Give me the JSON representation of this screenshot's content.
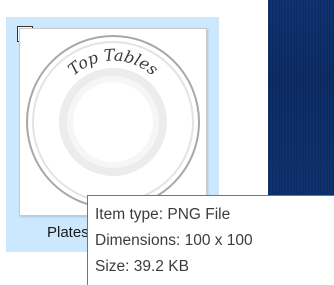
{
  "tile": {
    "label": "Plates",
    "selected": true,
    "thumbnail": {
      "plate_text": "Top Tables",
      "icon": "plate-image"
    }
  },
  "tooltip": {
    "item_type": "Item type: PNG File",
    "dimensions": "Dimensions: 100 x 100",
    "size": "Size: 39.2 KB"
  },
  "colors": {
    "selection_bg": "#cce8ff",
    "dark_panel": "#0c2e6b",
    "tooltip_border": "#767676"
  }
}
